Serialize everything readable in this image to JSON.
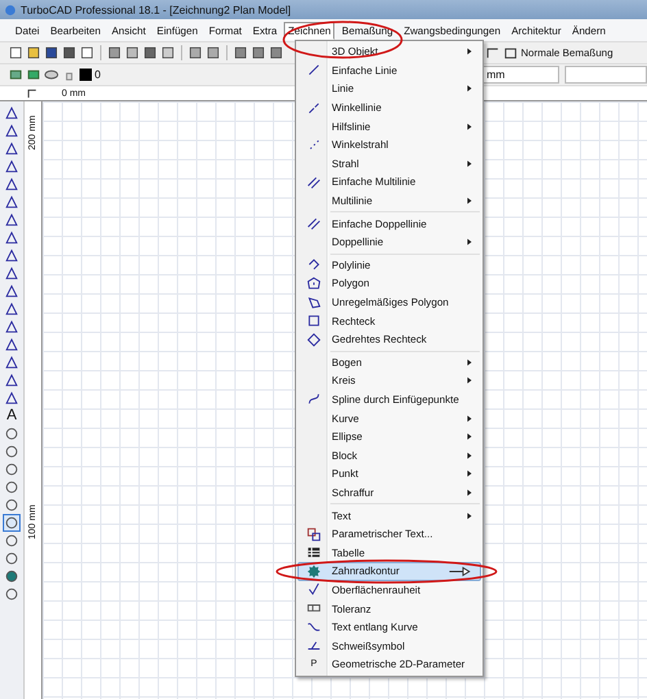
{
  "window": {
    "title": "TurboCAD Professional 18.1 - [Zeichnung2 Plan Model]"
  },
  "menubar": [
    {
      "label": "Datei",
      "selected": false
    },
    {
      "label": "Bearbeiten",
      "selected": false
    },
    {
      "label": "Ansicht",
      "selected": false
    },
    {
      "label": "Einfügen",
      "selected": false
    },
    {
      "label": "Format",
      "selected": false
    },
    {
      "label": "Extra",
      "selected": false
    },
    {
      "label": "Zeichnen",
      "selected": true
    },
    {
      "label": "Bemaßung",
      "selected": false
    },
    {
      "label": "Zwangsbedingungen",
      "selected": false
    },
    {
      "label": "Architektur",
      "selected": false
    },
    {
      "label": "Ändern",
      "selected": false
    }
  ],
  "toolbar": {
    "style_label": "Normale Bemaßung",
    "layer_value": "0",
    "unit": "mm"
  },
  "ruler": {
    "top_label": "0 mm",
    "side_labels": [
      "200 mm",
      "100 mm"
    ]
  },
  "left_toolbar": {
    "text_tool": "A"
  },
  "menu": {
    "items": [
      {
        "kind": "item",
        "label": "3D Objekt",
        "icon": false,
        "submenu": true,
        "selected": false
      },
      {
        "kind": "item",
        "label": "Einfache Linie",
        "icon": true,
        "submenu": false,
        "selected": false
      },
      {
        "kind": "item",
        "label": "Linie",
        "icon": false,
        "submenu": true,
        "selected": false
      },
      {
        "kind": "item",
        "label": "Winkellinie",
        "icon": true,
        "submenu": false,
        "selected": false
      },
      {
        "kind": "item",
        "label": "Hilfslinie",
        "icon": false,
        "submenu": true,
        "selected": false
      },
      {
        "kind": "item",
        "label": "Winkelstrahl",
        "icon": true,
        "submenu": false,
        "selected": false
      },
      {
        "kind": "item",
        "label": "Strahl",
        "icon": false,
        "submenu": true,
        "selected": false
      },
      {
        "kind": "item",
        "label": "Einfache Multilinie",
        "icon": true,
        "submenu": false,
        "selected": false
      },
      {
        "kind": "item",
        "label": "Multilinie",
        "icon": false,
        "submenu": true,
        "selected": false
      },
      {
        "kind": "separator"
      },
      {
        "kind": "item",
        "label": "Einfache Doppellinie",
        "icon": true,
        "submenu": false,
        "selected": false
      },
      {
        "kind": "item",
        "label": "Doppellinie",
        "icon": false,
        "submenu": true,
        "selected": false
      },
      {
        "kind": "separator"
      },
      {
        "kind": "item",
        "label": "Polylinie",
        "icon": true,
        "submenu": false,
        "selected": false
      },
      {
        "kind": "item",
        "label": "Polygon",
        "icon": true,
        "submenu": false,
        "selected": false
      },
      {
        "kind": "item",
        "label": "Unregelmäßiges Polygon",
        "icon": true,
        "submenu": false,
        "selected": false
      },
      {
        "kind": "item",
        "label": "Rechteck",
        "icon": true,
        "submenu": false,
        "selected": false
      },
      {
        "kind": "item",
        "label": "Gedrehtes Rechteck",
        "icon": true,
        "submenu": false,
        "selected": false
      },
      {
        "kind": "separator"
      },
      {
        "kind": "item",
        "label": "Bogen",
        "icon": false,
        "submenu": true,
        "selected": false
      },
      {
        "kind": "item",
        "label": "Kreis",
        "icon": false,
        "submenu": true,
        "selected": false
      },
      {
        "kind": "item",
        "label": "Spline durch Einfügepunkte",
        "icon": true,
        "submenu": false,
        "selected": false
      },
      {
        "kind": "item",
        "label": "Kurve",
        "icon": false,
        "submenu": true,
        "selected": false
      },
      {
        "kind": "item",
        "label": "Ellipse",
        "icon": false,
        "submenu": true,
        "selected": false
      },
      {
        "kind": "item",
        "label": "Block",
        "icon": false,
        "submenu": true,
        "selected": false
      },
      {
        "kind": "item",
        "label": "Punkt",
        "icon": false,
        "submenu": true,
        "selected": false
      },
      {
        "kind": "item",
        "label": "Schraffur",
        "icon": false,
        "submenu": true,
        "selected": false
      },
      {
        "kind": "separator"
      },
      {
        "kind": "item",
        "label": "Text",
        "icon": false,
        "submenu": true,
        "selected": false
      },
      {
        "kind": "item",
        "label": "Parametrischer Text...",
        "icon": true,
        "submenu": false,
        "selected": false
      },
      {
        "kind": "item",
        "label": "Tabelle",
        "icon": true,
        "submenu": false,
        "selected": false
      },
      {
        "kind": "item",
        "label": "Zahnradkontur",
        "icon": true,
        "submenu": false,
        "selected": true
      },
      {
        "kind": "item",
        "label": "Oberflächenrauheit",
        "icon": true,
        "submenu": false,
        "selected": false
      },
      {
        "kind": "item",
        "label": "Toleranz",
        "icon": true,
        "submenu": false,
        "selected": false
      },
      {
        "kind": "item",
        "label": "Text entlang Kurve",
        "icon": true,
        "submenu": false,
        "selected": false
      },
      {
        "kind": "item",
        "label": "Schweißsymbol",
        "icon": true,
        "submenu": false,
        "selected": false
      },
      {
        "kind": "item",
        "label": "Geometrische 2D-Parameter",
        "icon": false,
        "glyph": "P",
        "submenu": false,
        "selected": false
      }
    ]
  }
}
